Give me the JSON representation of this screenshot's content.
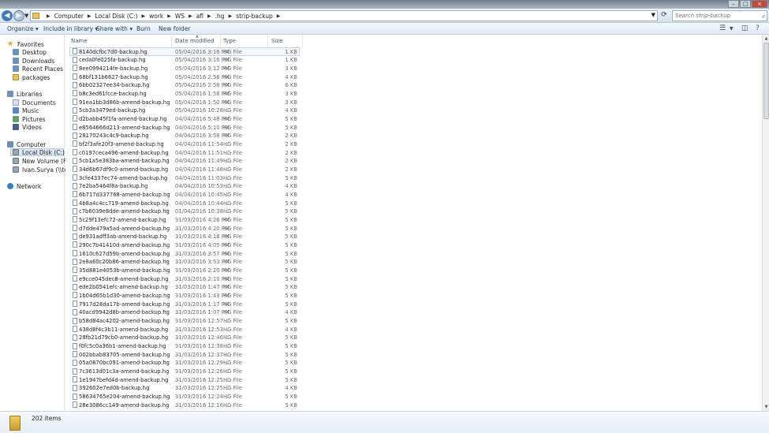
{
  "window": {
    "controls": [
      "minimize",
      "maximize",
      "close"
    ]
  },
  "address": {
    "crumbs": [
      "Computer",
      "Local Disk (C:)",
      "work",
      "WS",
      "afl",
      ".hg",
      "strip-backup"
    ],
    "search_placeholder": "Search strip-backup"
  },
  "toolbar": {
    "organize": "Organize ▾",
    "include_library": "Include in library ▾",
    "share_with": "Share with ▾",
    "burn": "Burn",
    "new_folder": "New folder"
  },
  "navigation": {
    "favorites": {
      "label": "Favorites",
      "items": [
        "Desktop",
        "Downloads",
        "Recent Places",
        "packages"
      ]
    },
    "libraries": {
      "label": "Libraries",
      "items": [
        "Documents",
        "Music",
        "Pictures",
        "Videos"
      ]
    },
    "computer": {
      "label": "Computer",
      "items": [
        "Local Disk (C:)",
        "New Volume (F:)",
        "Ivan.Surya (\\\\tor-sv-"
      ]
    },
    "network": {
      "label": "Network"
    }
  },
  "columns": {
    "name": "Name",
    "date": "Date modified",
    "type": "Type",
    "size": "Size"
  },
  "files": [
    {
      "name": "8140dcfbc7d0-backup.hg",
      "date": "05/04/2016 3:16 PM",
      "type": "HG File",
      "size": "1 KB"
    },
    {
      "name": "ceda0fe025fa-backup.hg",
      "date": "05/04/2016 3:16 PM",
      "type": "HG File",
      "size": "1 KB"
    },
    {
      "name": "8ee0994214fe-backup.hg",
      "date": "05/04/2016 3:12 PM",
      "type": "HG File",
      "size": "3 KB"
    },
    {
      "name": "68bf131b6627-backup.hg",
      "date": "05/04/2016 2:58 PM",
      "type": "HG File",
      "size": "4 KB"
    },
    {
      "name": "6bb02327ee34-backup.hg",
      "date": "05/04/2016 2:58 PM",
      "type": "HG File",
      "size": "6 KB"
    },
    {
      "name": "b8c3ed61fcce-backup.hg",
      "date": "05/04/2016 1:56 PM",
      "type": "HG File",
      "size": "3 KB"
    },
    {
      "name": "91ea1bb3d86b-amend-backup.hg",
      "date": "05/04/2016 1:50 PM",
      "type": "HG File",
      "size": "3 KB"
    },
    {
      "name": "5cb3a3479ed-backup.hg",
      "date": "05/04/2016 10:28 ...",
      "type": "HG File",
      "size": "4 KB"
    },
    {
      "name": "d2babb45f1fa-amend-backup.hg",
      "date": "04/04/2016 5:48 PM",
      "type": "HG File",
      "size": "5 KB"
    },
    {
      "name": "e8564666d213-amend-backup.hg",
      "date": "04/04/2016 5:10 PM",
      "type": "HG File",
      "size": "5 KB"
    },
    {
      "name": "28170243c4c9-backup.hg",
      "date": "04/04/2016 3:58 PM",
      "type": "HG File",
      "size": "2 KB"
    },
    {
      "name": "bf2f3afe20f3-amend-backup.hg",
      "date": "04/04/2016 11:54 ...",
      "type": "HG File",
      "size": "2 KB"
    },
    {
      "name": "c0197ceca496-amend-backup.hg",
      "date": "04/04/2016 11:51 ...",
      "type": "HG File",
      "size": "2 KB"
    },
    {
      "name": "5cb1a5e383ba-amend-backup.hg",
      "date": "04/04/2016 11:49 ...",
      "type": "HG File",
      "size": "2 KB"
    },
    {
      "name": "34d6b67df9c0-amend-backup.hg",
      "date": "04/04/2016 11:48 ...",
      "type": "HG File",
      "size": "2 KB"
    },
    {
      "name": "3cfe4337ec74-amend-backup.hg",
      "date": "04/04/2016 11:03 ...",
      "type": "HG File",
      "size": "5 KB"
    },
    {
      "name": "7e2ba5464f8a-backup.hg",
      "date": "04/04/2016 10:53 ...",
      "type": "HG File",
      "size": "4 KB"
    },
    {
      "name": "6b717d337768-amend-backup.hg",
      "date": "04/04/2016 10:45 ...",
      "type": "HG File",
      "size": "4 KB"
    },
    {
      "name": "4b8a4c4cc719-amend-backup.hg",
      "date": "04/04/2016 10:44 ...",
      "type": "HG File",
      "size": "5 KB"
    },
    {
      "name": "c7b6039e8dde-amend-backup.hg",
      "date": "01/04/2016 10:38 ...",
      "type": "HG File",
      "size": "5 KB"
    },
    {
      "name": "5c29f13efc72-amend-backup.hg",
      "date": "31/03/2016 4:26 PM",
      "type": "HG File",
      "size": "5 KB"
    },
    {
      "name": "d7dde479a5ad-amend-backup.hg",
      "date": "31/03/2016 4:20 PM",
      "type": "HG File",
      "size": "5 KB"
    },
    {
      "name": "de931adff3ab-amend-backup.hg",
      "date": "31/03/2016 4:18 PM",
      "type": "HG File",
      "size": "5 KB"
    },
    {
      "name": "290c7b41410d-amend-backup.hg",
      "date": "31/03/2016 4:05 PM",
      "type": "HG File",
      "size": "5 KB"
    },
    {
      "name": "1610c627d59b-amend-backup.hg",
      "date": "31/03/2016 3:57 PM",
      "type": "HG File",
      "size": "5 KB"
    },
    {
      "name": "2e8a60c20b86-amend-backup.hg",
      "date": "31/03/2016 3:53 PM",
      "type": "HG File",
      "size": "5 KB"
    },
    {
      "name": "35d881e4053b-amend-backup.hg",
      "date": "31/03/2016 2:20 PM",
      "type": "HG File",
      "size": "5 KB"
    },
    {
      "name": "e9cce045dec8-amend-backup.hg",
      "date": "31/03/2016 2:10 PM",
      "type": "HG File",
      "size": "5 KB"
    },
    {
      "name": "ede2b0541efc-amend-backup.hg",
      "date": "31/03/2016 1:47 PM",
      "type": "HG File",
      "size": "5 KB"
    },
    {
      "name": "1b04d65b1d30-amend-backup.hg",
      "date": "31/03/2016 1:43 PM",
      "type": "HG File",
      "size": "5 KB"
    },
    {
      "name": "7917d28da17b-amend-backup.hg",
      "date": "31/03/2016 1:17 PM",
      "type": "HG File",
      "size": "5 KB"
    },
    {
      "name": "40acd9942d8b-amend-backup.hg",
      "date": "31/03/2016 1:07 PM",
      "type": "HG File",
      "size": "4 KB"
    },
    {
      "name": "b58d84ac4202-amend-backup.hg",
      "date": "31/03/2016 12:57 ...",
      "type": "HG File",
      "size": "5 KB"
    },
    {
      "name": "438d8f4c3b11-amend-backup.hg",
      "date": "31/03/2016 12:53 ...",
      "type": "HG File",
      "size": "4 KB"
    },
    {
      "name": "28fb21d79cb0-amend-backup.hg",
      "date": "31/03/2016 12:46 ...",
      "type": "HG File",
      "size": "5 KB"
    },
    {
      "name": "f0fc5c0a36b1-amend-backup.hg",
      "date": "31/03/2016 12:38 ...",
      "type": "HG File",
      "size": "5 KB"
    },
    {
      "name": "002bbab83705-amend-backup.hg",
      "date": "31/03/2016 12:37 ...",
      "type": "HG File",
      "size": "5 KB"
    },
    {
      "name": "05a0870bc091-amend-backup.hg",
      "date": "31/03/2016 12:29 ...",
      "type": "HG File",
      "size": "5 KB"
    },
    {
      "name": "7c3613d01c3a-amend-backup.hg",
      "date": "31/03/2016 12:26 ...",
      "type": "HG File",
      "size": "5 KB"
    },
    {
      "name": "1e1947befd4d-amend-backup.hg",
      "date": "31/03/2016 12:25 ...",
      "type": "HG File",
      "size": "5 KB"
    },
    {
      "name": "392602e7ed0b-backup.hg",
      "date": "31/03/2016 12:25 ...",
      "type": "HG File",
      "size": "4 KB"
    },
    {
      "name": "58634765e204-amend-backup.hg",
      "date": "31/03/2016 12:24 ...",
      "type": "HG File",
      "size": "5 KB"
    },
    {
      "name": "28e3086cc149-amend-backup.hg",
      "date": "31/03/2016 12:16 ...",
      "type": "HG File",
      "size": "5 KB"
    }
  ],
  "status": {
    "item_count": "202 items"
  }
}
